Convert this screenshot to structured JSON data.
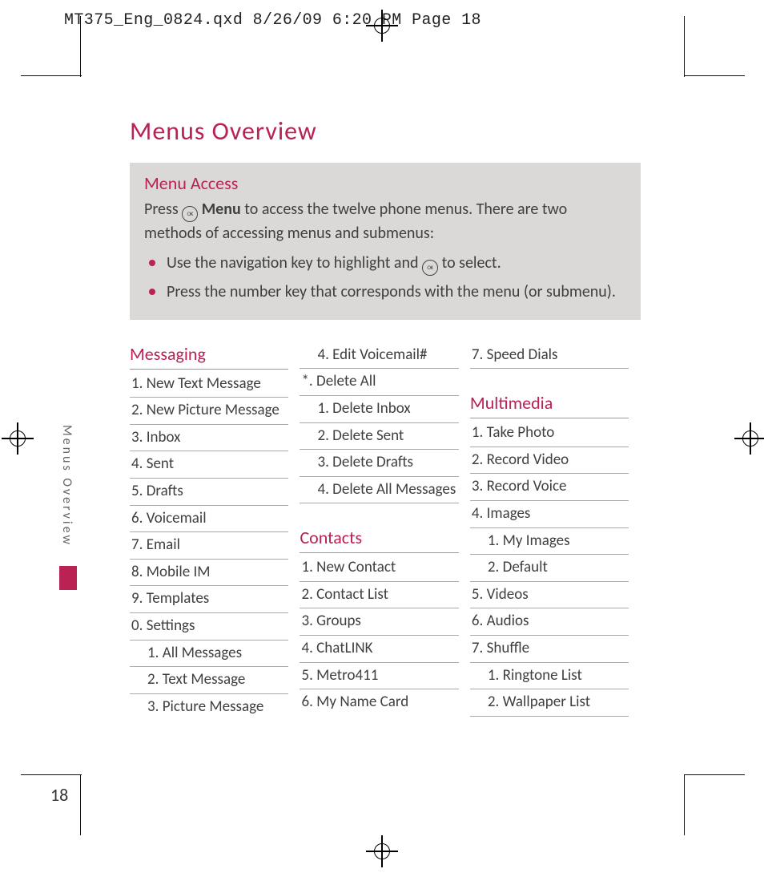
{
  "slugline": "MT375_Eng_0824.qxd  8/26/09  6:20 PM  Page 18",
  "title": "Menus Overview",
  "access": {
    "heading": "Menu Access",
    "press": "Press ",
    "ok_glyph": "OK",
    "menu_bold": " Menu",
    "para_rest": " to access the twelve phone menus. There are two methods of accessing menus and submenus:",
    "bullets": {
      "b1_a": "Use the navigation key to highlight and ",
      "b1_b": " to select.",
      "b2": "Press the number key that corresponds with the menu (or submenu)."
    }
  },
  "sections": {
    "messaging": {
      "head": "Messaging",
      "i1": "1. New Text Message",
      "i2": "2. New Picture Message",
      "i3": "3. Inbox",
      "i4": "4. Sent",
      "i5": "5. Drafts",
      "i6": "6. Voicemail",
      "i7": "7.  Email",
      "i8": "8.  Mobile IM",
      "i9": "9. Templates",
      "i10": "0. Settings",
      "s10_1": "1. All Messages",
      "s10_2": "2. Text Message",
      "s10_3": "3. Picture Message",
      "s10_4": "4. Edit Voicemail#",
      "istar": "*. Delete All",
      "sstar_1": "1. Delete Inbox",
      "sstar_2": "2. Delete Sent",
      "sstar_3": "3. Delete Drafts",
      "sstar_4": "4. Delete All Messages"
    },
    "contacts": {
      "head": "Contacts",
      "i1": "1. New Contact",
      "i2": "2. Contact List",
      "i3": "3. Groups",
      "i4": "4. ChatLINK",
      "i5": "5. Metro411",
      "i6": "6. My Name Card",
      "i7": "7.  Speed Dials"
    },
    "multimedia": {
      "head": "Multimedia",
      "i1": "1.  Take Photo",
      "i2": "2.  Record Video",
      "i3": "3.  Record Voice",
      "i4": "4. Images",
      "s4_1": "1. My Images",
      "s4_2": "2. Default",
      "i5": "5.  Videos",
      "i6": "6.  Audios",
      "i7": "7.  Shuffle",
      "s7_1": "1. Ringtone List",
      "s7_2": "2. Wallpaper List"
    }
  },
  "side_label": "Menus Overview",
  "page_number": "18"
}
